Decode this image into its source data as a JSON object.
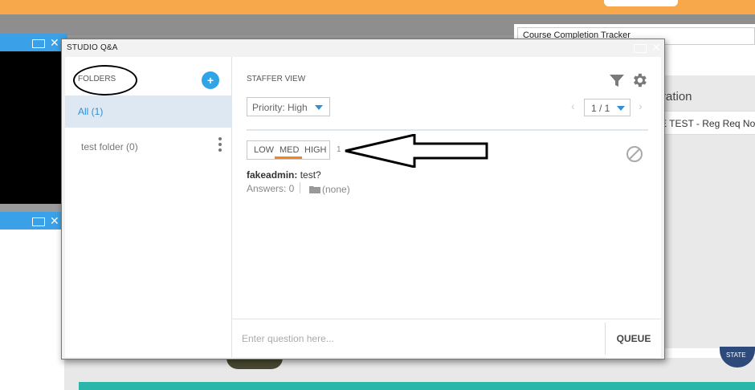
{
  "background": {
    "tracker_title": "Course Completion Tracker",
    "side_title": "ration",
    "side_row": "E TEST - Reg Req No",
    "seal_text": "STATE"
  },
  "dialog": {
    "title": "STUDIO Q&A"
  },
  "folders": {
    "header": "FOLDERS",
    "add_label": "+",
    "items": [
      {
        "label": "All (1)",
        "selected": true
      },
      {
        "label": "test folder (0)",
        "selected": false
      }
    ]
  },
  "staffer": {
    "header": "STAFFER VIEW",
    "priority_select": "Priority: High",
    "pager": "1 / 1",
    "prev": "‹",
    "next": "›"
  },
  "question": {
    "priority": {
      "low": "LOW",
      "med": "MED",
      "high": "HIGH",
      "selected": "MED"
    },
    "votes": "1",
    "user": "fakeadmin:",
    "text": "test?",
    "answers": "Answers: 0",
    "folder": "(none)"
  },
  "compose": {
    "placeholder": "Enter question here...",
    "submit_label": "QUEUE"
  },
  "colors": {
    "accent_blue": "#2fa4e7",
    "priority_underline": "#f5821f",
    "banner": "#f7a84a"
  }
}
